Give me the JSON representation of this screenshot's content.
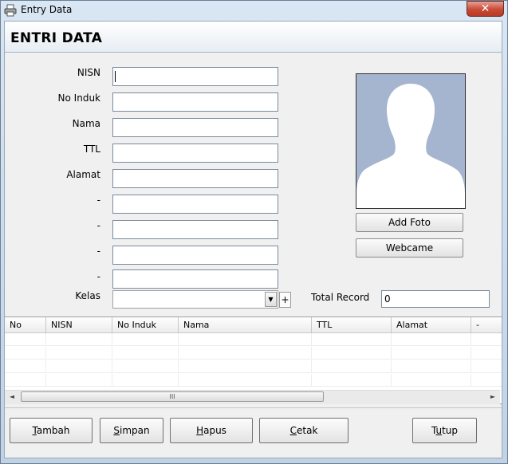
{
  "window": {
    "title": "Entry Data",
    "close_glyph": "✕"
  },
  "header": {
    "title": "ENTRI DATA"
  },
  "form": {
    "labels": {
      "nisn": "NISN",
      "no_induk": "No Induk",
      "nama": "Nama",
      "ttl": "TTL",
      "alamat": "Alamat",
      "dash1": "-",
      "dash2": "-",
      "dash3": "-",
      "dash4": "-",
      "kelas": "Kelas"
    },
    "values": {
      "nisn": "",
      "no_induk": "",
      "nama": "",
      "ttl": "",
      "alamat": "",
      "dash1": "",
      "dash2": "",
      "dash3": "",
      "dash4": "",
      "kelas": ""
    },
    "kelas_add_label": "+",
    "kelas_dropdown_glyph": "▼"
  },
  "photo_panel": {
    "add_foto_label": "Add Foto",
    "webcame_label": "Webcame",
    "placeholder_icon": "person-silhouette-icon"
  },
  "total_record": {
    "label": "Total Record",
    "value": "0"
  },
  "grid": {
    "columns": [
      "No",
      "NISN",
      "No Induk",
      "Nama",
      "TTL",
      "Alamat",
      "-"
    ],
    "rows": [],
    "scroll_left_glyph": "◄",
    "scroll_right_glyph": "►",
    "thumb_grip": "III"
  },
  "footer": {
    "buttons": {
      "tambah": {
        "mnemonic": "T",
        "rest": "ambah"
      },
      "simpan": {
        "mnemonic": "S",
        "rest": "impan"
      },
      "hapus": {
        "mnemonic": "H",
        "rest": "apus"
      },
      "cetak": {
        "mnemonic": "C",
        "rest": "etak"
      },
      "tutup": {
        "pre": "T",
        "mnemonic": "u",
        "rest": "tup"
      }
    }
  },
  "colors": {
    "photo_bg": "#a5b4cf",
    "silhouette": "#ffffff",
    "close_button": "#c74a35"
  }
}
